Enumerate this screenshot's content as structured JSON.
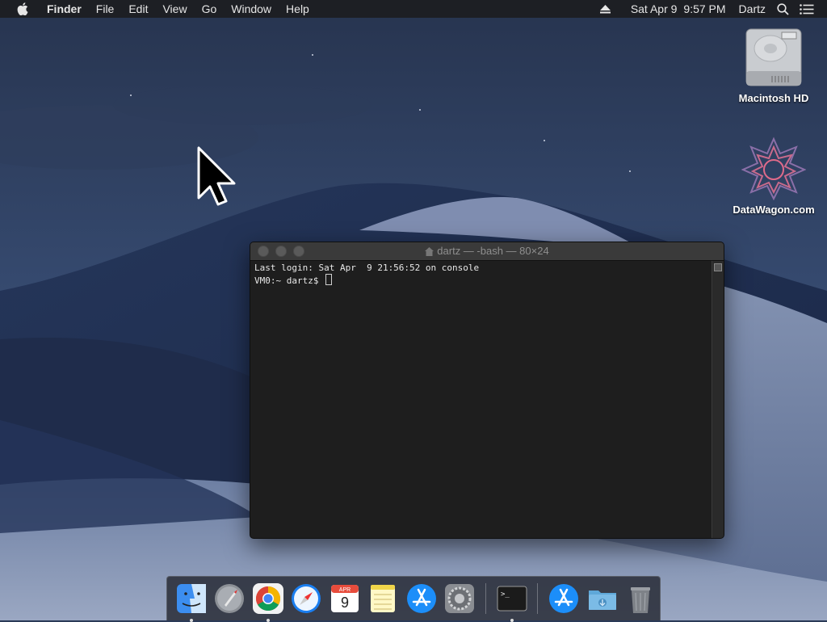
{
  "menubar": {
    "app_name": "Finder",
    "menus": [
      "File",
      "Edit",
      "View",
      "Go",
      "Window",
      "Help"
    ],
    "date": "Sat Apr 9",
    "time": "9:57 PM",
    "user": "Dartz"
  },
  "desktop": {
    "icons": [
      {
        "label": "Macintosh HD",
        "icon": "hard-drive-icon"
      },
      {
        "label": "DataWagon.com",
        "icon": "datawagon-logo-icon"
      }
    ]
  },
  "terminal": {
    "title": "dartz — -bash — 80×24",
    "lines": [
      "Last login: Sat Apr  9 21:56:52 on console",
      "VM0:~ dartz$ "
    ]
  },
  "dock": {
    "apps": [
      {
        "name": "Finder",
        "icon": "finder-icon",
        "running": true
      },
      {
        "name": "Launchpad",
        "icon": "launchpad-icon",
        "running": false
      },
      {
        "name": "Google Chrome",
        "icon": "chrome-icon",
        "running": true
      },
      {
        "name": "Safari",
        "icon": "safari-icon",
        "running": false
      },
      {
        "name": "Calendar",
        "icon": "calendar-icon",
        "running": false,
        "month": "APR",
        "day": "9"
      },
      {
        "name": "Notes",
        "icon": "notes-icon",
        "running": false
      },
      {
        "name": "App Store",
        "icon": "app-store-icon",
        "running": false
      },
      {
        "name": "System Preferences",
        "icon": "system-preferences-icon",
        "running": false
      },
      {
        "name": "Terminal",
        "icon": "terminal-icon",
        "running": true
      },
      {
        "name": "App Store",
        "icon": "app-store-icon",
        "running": false
      },
      {
        "name": "Downloads",
        "icon": "downloads-folder-icon",
        "running": false
      },
      {
        "name": "Trash",
        "icon": "trash-icon",
        "running": false
      }
    ]
  },
  "colors": {
    "menubar_bg": "#1d1f24",
    "terminal_bg": "#1e1e1e",
    "terminal_titlebar": "#3a3a3a"
  }
}
